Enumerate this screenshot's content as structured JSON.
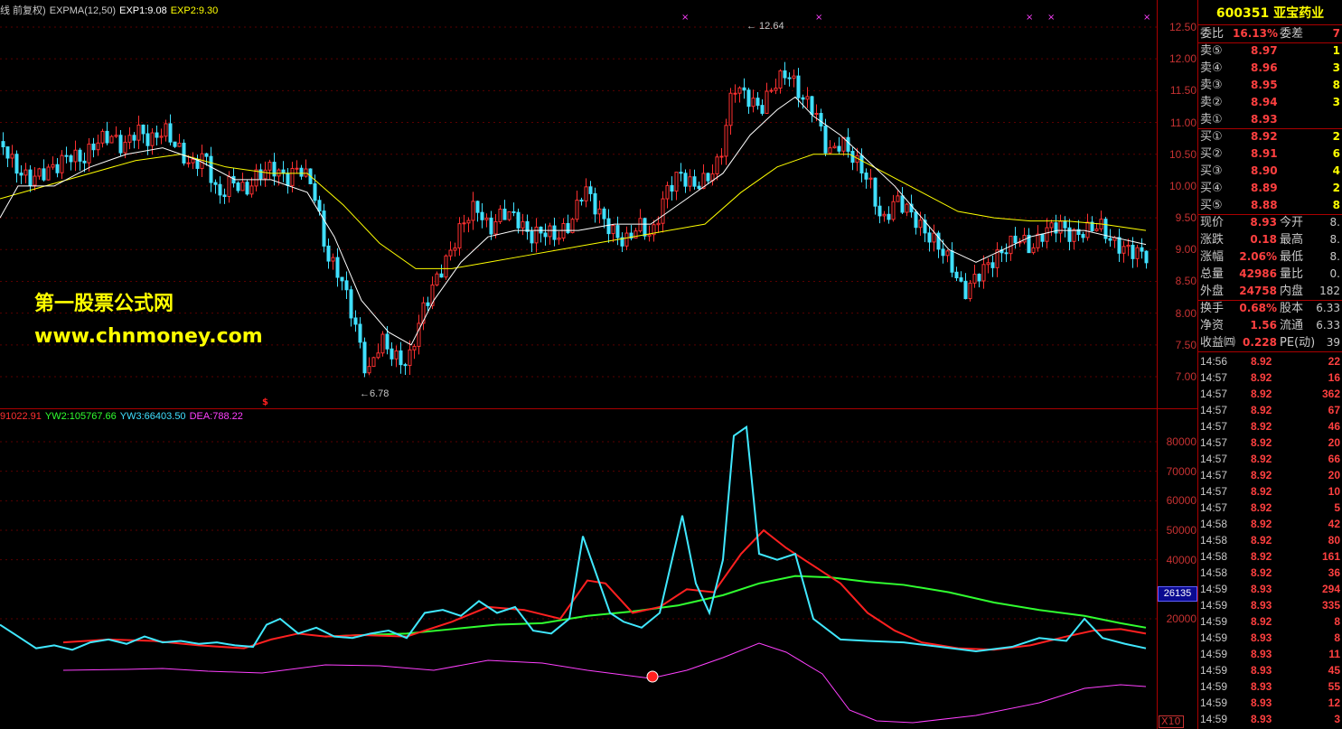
{
  "legend_top": {
    "items": [
      {
        "text": "线 前复权)",
        "color": "#c8c8c8"
      },
      {
        "text": "EXPMA(12,50)",
        "color": "#c8c8c8"
      },
      {
        "text": "EXP1:9.08",
        "color": "#ffffff"
      },
      {
        "text": "EXP2:9.30",
        "color": "#ffff00"
      }
    ]
  },
  "legend_bottom": {
    "items": [
      {
        "text": "91022.91",
        "color": "#ff3030"
      },
      {
        "text": "YW2:105767.66",
        "color": "#30ff30"
      },
      {
        "text": "YW3:66403.50",
        "color": "#40e0ff"
      },
      {
        "text": "DEA:788.22",
        "color": "#ff40ff"
      }
    ]
  },
  "watermark": {
    "line1": "第一股票公式网",
    "line2": "www.chnmoney.com"
  },
  "price_labels": {
    "high": "12.64",
    "low": "6.78"
  },
  "axis_top": [
    "12.50",
    "12.00",
    "11.50",
    "11.00",
    "10.50",
    "10.00",
    "9.50",
    "9.00",
    "8.50",
    "8.00",
    "7.50",
    "7.00"
  ],
  "axis_bottom": [
    "80000",
    "70000",
    "60000",
    "50000",
    "40000",
    "20000"
  ],
  "current_badge": "26135",
  "x10_badge": "X10",
  "colors": {
    "up": "#ff3030",
    "down": "#40e0ff",
    "exp1": "#ffffff",
    "exp2": "#ffff00",
    "yw1": "#ff2020",
    "yw2": "#30ff30",
    "yw3": "#40e8ff",
    "dea": "#ff40ff"
  },
  "panel": {
    "title": "600351 亚宝药业",
    "weibi": {
      "label1": "委比",
      "val1": "16.13%",
      "label2": "委差",
      "val2": "7"
    },
    "sell": [
      {
        "label": "卖⑤",
        "price": "8.97",
        "vol": "1"
      },
      {
        "label": "卖④",
        "price": "8.96",
        "vol": "3"
      },
      {
        "label": "卖③",
        "price": "8.95",
        "vol": "8"
      },
      {
        "label": "卖②",
        "price": "8.94",
        "vol": "3"
      },
      {
        "label": "卖①",
        "price": "8.93",
        "vol": ""
      }
    ],
    "buy": [
      {
        "label": "买①",
        "price": "8.92",
        "vol": "2"
      },
      {
        "label": "买②",
        "price": "8.91",
        "vol": "6"
      },
      {
        "label": "买③",
        "price": "8.90",
        "vol": "4"
      },
      {
        "label": "买④",
        "price": "8.89",
        "vol": "2"
      },
      {
        "label": "买⑤",
        "price": "8.88",
        "vol": "8"
      }
    ],
    "quote": [
      {
        "l1": "现价",
        "v1": "8.93",
        "l2": "今开",
        "v2": "8."
      },
      {
        "l1": "涨跌",
        "v1": "0.18",
        "l2": "最高",
        "v2": "8."
      },
      {
        "l1": "涨幅",
        "v1": "2.06%",
        "l2": "最低",
        "v2": "8."
      },
      {
        "l1": "总量",
        "v1": "42986",
        "l2": "量比",
        "v2": "0."
      },
      {
        "l1": "外盘",
        "v1": "24758",
        "l2": "内盘",
        "v2": "182"
      }
    ],
    "info": [
      {
        "l1": "换手",
        "v1": "0.68%",
        "l2": "股本",
        "v2": "6.33"
      },
      {
        "l1": "净资",
        "v1": "1.56",
        "l2": "流通",
        "v2": "6.33"
      },
      {
        "l1": "收益㈣",
        "v1": "0.228",
        "l2": "PE(动)",
        "v2": "39"
      }
    ],
    "ticks": [
      {
        "t": "14:56",
        "p": "8.92",
        "v": "22"
      },
      {
        "t": "14:57",
        "p": "8.92",
        "v": "16"
      },
      {
        "t": "14:57",
        "p": "8.92",
        "v": "362"
      },
      {
        "t": "14:57",
        "p": "8.92",
        "v": "67"
      },
      {
        "t": "14:57",
        "p": "8.92",
        "v": "46"
      },
      {
        "t": "14:57",
        "p": "8.92",
        "v": "20"
      },
      {
        "t": "14:57",
        "p": "8.92",
        "v": "66"
      },
      {
        "t": "14:57",
        "p": "8.92",
        "v": "20"
      },
      {
        "t": "14:57",
        "p": "8.92",
        "v": "10"
      },
      {
        "t": "14:57",
        "p": "8.92",
        "v": "5"
      },
      {
        "t": "14:58",
        "p": "8.92",
        "v": "42"
      },
      {
        "t": "14:58",
        "p": "8.92",
        "v": "80"
      },
      {
        "t": "14:58",
        "p": "8.92",
        "v": "161"
      },
      {
        "t": "14:58",
        "p": "8.92",
        "v": "36"
      },
      {
        "t": "14:59",
        "p": "8.93",
        "v": "294"
      },
      {
        "t": "14:59",
        "p": "8.93",
        "v": "335"
      },
      {
        "t": "14:59",
        "p": "8.92",
        "v": "8"
      },
      {
        "t": "14:59",
        "p": "8.93",
        "v": "8"
      },
      {
        "t": "14:59",
        "p": "8.93",
        "v": "11"
      },
      {
        "t": "14:59",
        "p": "8.93",
        "v": "45"
      },
      {
        "t": "14:59",
        "p": "8.93",
        "v": "55"
      },
      {
        "t": "14:59",
        "p": "8.93",
        "v": "12"
      },
      {
        "t": "14:59",
        "p": "8.93",
        "v": "3"
      }
    ]
  },
  "series": {
    "close_path": [
      [
        0,
        10.7
      ],
      [
        15,
        10.3
      ],
      [
        30,
        10.1
      ],
      [
        45,
        10.2
      ],
      [
        60,
        10.3
      ],
      [
        75,
        10.5
      ],
      [
        90,
        10.4
      ],
      [
        105,
        10.7
      ],
      [
        120,
        10.8
      ],
      [
        135,
        10.6
      ],
      [
        150,
        10.9
      ],
      [
        165,
        10.7
      ],
      [
        180,
        10.9
      ],
      [
        195,
        10.6
      ],
      [
        210,
        10.3
      ],
      [
        225,
        10.5
      ],
      [
        240,
        9.8
      ],
      [
        255,
        10.1
      ],
      [
        270,
        9.9
      ],
      [
        285,
        10.2
      ],
      [
        300,
        10.3
      ],
      [
        315,
        10.1
      ],
      [
        330,
        10.3
      ],
      [
        345,
        10.0
      ],
      [
        360,
        8.9
      ],
      [
        375,
        8.6
      ],
      [
        390,
        7.9
      ],
      [
        405,
        7.0
      ],
      [
        420,
        7.6
      ],
      [
        435,
        7.3
      ],
      [
        450,
        7.2
      ],
      [
        465,
        8.0
      ],
      [
        480,
        8.5
      ],
      [
        495,
        8.9
      ],
      [
        510,
        9.4
      ],
      [
        525,
        9.7
      ],
      [
        540,
        9.3
      ],
      [
        555,
        9.6
      ],
      [
        570,
        9.5
      ],
      [
        585,
        9.2
      ],
      [
        600,
        9.3
      ],
      [
        615,
        9.2
      ],
      [
        630,
        9.4
      ],
      [
        645,
        10.0
      ],
      [
        660,
        9.6
      ],
      [
        675,
        9.3
      ],
      [
        690,
        9.1
      ],
      [
        705,
        9.4
      ],
      [
        720,
        9.2
      ],
      [
        735,
        9.9
      ],
      [
        750,
        10.2
      ],
      [
        765,
        10.0
      ],
      [
        780,
        10.1
      ],
      [
        795,
        10.4
      ],
      [
        810,
        11.6
      ],
      [
        825,
        11.4
      ],
      [
        840,
        11.2
      ],
      [
        855,
        11.6
      ],
      [
        870,
        11.8
      ],
      [
        885,
        11.4
      ],
      [
        900,
        11.2
      ],
      [
        915,
        10.5
      ],
      [
        930,
        10.7
      ],
      [
        945,
        10.4
      ],
      [
        960,
        10.1
      ],
      [
        975,
        9.4
      ],
      [
        990,
        9.8
      ],
      [
        1005,
        9.6
      ],
      [
        1020,
        9.3
      ],
      [
        1035,
        9.1
      ],
      [
        1050,
        8.8
      ],
      [
        1065,
        8.3
      ],
      [
        1080,
        8.6
      ],
      [
        1095,
        8.8
      ],
      [
        1110,
        9.0
      ],
      [
        1125,
        9.2
      ],
      [
        1140,
        9.0
      ],
      [
        1155,
        9.3
      ],
      [
        1170,
        9.4
      ],
      [
        1185,
        9.2
      ],
      [
        1200,
        9.3
      ],
      [
        1215,
        9.4
      ],
      [
        1230,
        9.1
      ],
      [
        1245,
        9.0
      ],
      [
        1260,
        8.95
      ],
      [
        1268,
        8.9
      ]
    ],
    "exp1": [
      [
        0,
        9.5
      ],
      [
        20,
        10.0
      ],
      [
        60,
        10.0
      ],
      [
        100,
        10.3
      ],
      [
        140,
        10.5
      ],
      [
        180,
        10.6
      ],
      [
        220,
        10.4
      ],
      [
        260,
        10.1
      ],
      [
        300,
        10.1
      ],
      [
        340,
        9.9
      ],
      [
        370,
        9.2
      ],
      [
        400,
        8.2
      ],
      [
        430,
        7.7
      ],
      [
        455,
        7.5
      ],
      [
        480,
        8.2
      ],
      [
        510,
        8.8
      ],
      [
        540,
        9.2
      ],
      [
        570,
        9.3
      ],
      [
        600,
        9.3
      ],
      [
        640,
        9.3
      ],
      [
        680,
        9.4
      ],
      [
        720,
        9.4
      ],
      [
        760,
        9.8
      ],
      [
        800,
        10.2
      ],
      [
        830,
        10.8
      ],
      [
        860,
        11.2
      ],
      [
        880,
        11.4
      ],
      [
        900,
        11.1
      ],
      [
        930,
        10.8
      ],
      [
        960,
        10.4
      ],
      [
        990,
        10.0
      ],
      [
        1020,
        9.5
      ],
      [
        1050,
        9.0
      ],
      [
        1080,
        8.8
      ],
      [
        1110,
        9.0
      ],
      [
        1140,
        9.2
      ],
      [
        1170,
        9.3
      ],
      [
        1200,
        9.3
      ],
      [
        1230,
        9.2
      ],
      [
        1268,
        9.08
      ]
    ],
    "exp2": [
      [
        0,
        9.8
      ],
      [
        50,
        10.0
      ],
      [
        100,
        10.2
      ],
      [
        150,
        10.4
      ],
      [
        200,
        10.5
      ],
      [
        250,
        10.3
      ],
      [
        300,
        10.2
      ],
      [
        340,
        10.2
      ],
      [
        380,
        9.7
      ],
      [
        420,
        9.1
      ],
      [
        460,
        8.7
      ],
      [
        500,
        8.7
      ],
      [
        540,
        8.8
      ],
      [
        580,
        8.9
      ],
      [
        620,
        9.0
      ],
      [
        660,
        9.1
      ],
      [
        700,
        9.2
      ],
      [
        740,
        9.3
      ],
      [
        780,
        9.4
      ],
      [
        820,
        9.9
      ],
      [
        860,
        10.3
      ],
      [
        900,
        10.5
      ],
      [
        940,
        10.5
      ],
      [
        980,
        10.2
      ],
      [
        1020,
        9.9
      ],
      [
        1060,
        9.6
      ],
      [
        1100,
        9.5
      ],
      [
        1140,
        9.45
      ],
      [
        1180,
        9.45
      ],
      [
        1220,
        9.4
      ],
      [
        1268,
        9.3
      ]
    ],
    "yw1": [
      [
        70,
        12000
      ],
      [
        120,
        13000
      ],
      [
        170,
        12500
      ],
      [
        220,
        11000
      ],
      [
        270,
        10000
      ],
      [
        300,
        13000
      ],
      [
        330,
        15000
      ],
      [
        360,
        14000
      ],
      [
        400,
        14500
      ],
      [
        450,
        14000
      ],
      [
        500,
        19000
      ],
      [
        540,
        24000
      ],
      [
        580,
        23000
      ],
      [
        620,
        20000
      ],
      [
        650,
        33000
      ],
      [
        670,
        32000
      ],
      [
        700,
        22000
      ],
      [
        730,
        24000
      ],
      [
        760,
        30000
      ],
      [
        790,
        29000
      ],
      [
        820,
        42000
      ],
      [
        845,
        50000
      ],
      [
        870,
        44000
      ],
      [
        900,
        38000
      ],
      [
        930,
        32000
      ],
      [
        960,
        22000
      ],
      [
        990,
        16000
      ],
      [
        1020,
        12000
      ],
      [
        1060,
        10000
      ],
      [
        1100,
        9500
      ],
      [
        1140,
        11000
      ],
      [
        1180,
        14000
      ],
      [
        1210,
        16000
      ],
      [
        1240,
        16500
      ],
      [
        1268,
        15000
      ]
    ],
    "yw2": [
      [
        360,
        14000
      ],
      [
        400,
        14500
      ],
      [
        450,
        15000
      ],
      [
        500,
        16500
      ],
      [
        550,
        18000
      ],
      [
        600,
        18500
      ],
      [
        650,
        21000
      ],
      [
        700,
        22500
      ],
      [
        750,
        24500
      ],
      [
        800,
        28000
      ],
      [
        840,
        32000
      ],
      [
        880,
        34500
      ],
      [
        920,
        34000
      ],
      [
        960,
        32500
      ],
      [
        1000,
        31500
      ],
      [
        1050,
        29000
      ],
      [
        1100,
        25500
      ],
      [
        1150,
        23000
      ],
      [
        1200,
        21000
      ],
      [
        1240,
        18500
      ],
      [
        1268,
        17000
      ]
    ],
    "yw3": [
      [
        0,
        18000
      ],
      [
        20,
        14000
      ],
      [
        40,
        10000
      ],
      [
        60,
        11000
      ],
      [
        80,
        9500
      ],
      [
        100,
        12000
      ],
      [
        120,
        13000
      ],
      [
        140,
        11500
      ],
      [
        160,
        14000
      ],
      [
        180,
        12000
      ],
      [
        200,
        12500
      ],
      [
        220,
        11500
      ],
      [
        240,
        12000
      ],
      [
        260,
        11000
      ],
      [
        280,
        10500
      ],
      [
        295,
        18000
      ],
      [
        310,
        20000
      ],
      [
        330,
        15000
      ],
      [
        350,
        17000
      ],
      [
        370,
        14000
      ],
      [
        390,
        13500
      ],
      [
        410,
        15000
      ],
      [
        430,
        16000
      ],
      [
        450,
        13500
      ],
      [
        470,
        22000
      ],
      [
        490,
        23000
      ],
      [
        510,
        21000
      ],
      [
        530,
        26000
      ],
      [
        550,
        22000
      ],
      [
        570,
        24000
      ],
      [
        590,
        16000
      ],
      [
        610,
        15000
      ],
      [
        630,
        20000
      ],
      [
        645,
        48000
      ],
      [
        660,
        35000
      ],
      [
        675,
        22000
      ],
      [
        690,
        19000
      ],
      [
        710,
        17000
      ],
      [
        730,
        22000
      ],
      [
        755,
        55000
      ],
      [
        770,
        32000
      ],
      [
        785,
        22000
      ],
      [
        800,
        40000
      ],
      [
        812,
        82000
      ],
      [
        826,
        85000
      ],
      [
        840,
        42000
      ],
      [
        860,
        40000
      ],
      [
        880,
        42000
      ],
      [
        900,
        20000
      ],
      [
        930,
        13000
      ],
      [
        960,
        12500
      ],
      [
        1000,
        12000
      ],
      [
        1040,
        10500
      ],
      [
        1080,
        9000
      ],
      [
        1120,
        10500
      ],
      [
        1150,
        13500
      ],
      [
        1180,
        12500
      ],
      [
        1200,
        20000
      ],
      [
        1220,
        13500
      ],
      [
        1245,
        11500
      ],
      [
        1268,
        10000
      ]
    ],
    "dea": [
      [
        70,
        3000
      ],
      [
        140,
        3500
      ],
      [
        180,
        4000
      ],
      [
        230,
        2500
      ],
      [
        290,
        1500
      ],
      [
        360,
        6000
      ],
      [
        420,
        5500
      ],
      [
        480,
        3000
      ],
      [
        540,
        8500
      ],
      [
        600,
        7000
      ],
      [
        650,
        3000
      ],
      [
        720,
        -1500
      ],
      [
        760,
        3000
      ],
      [
        800,
        10000
      ],
      [
        840,
        18000
      ],
      [
        870,
        13000
      ],
      [
        910,
        1000
      ],
      [
        940,
        -19000
      ],
      [
        970,
        -25000
      ],
      [
        1010,
        -26000
      ],
      [
        1080,
        -22000
      ],
      [
        1150,
        -15000
      ],
      [
        1200,
        -7000
      ],
      [
        1240,
        -5000
      ],
      [
        1268,
        -6000
      ]
    ],
    "candles_step": 15
  }
}
